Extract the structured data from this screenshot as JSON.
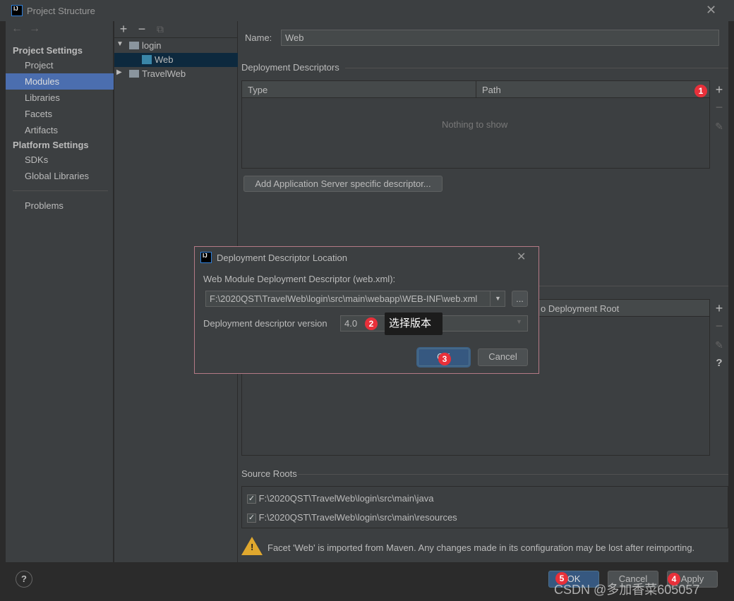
{
  "window": {
    "title": "Project Structure",
    "logo": "IJ"
  },
  "sidebar": {
    "nav": {
      "back": "←",
      "forward": "→"
    },
    "project_settings": "Project Settings",
    "project_items": [
      {
        "label": "Project"
      },
      {
        "label": "Modules",
        "selected": true
      },
      {
        "label": "Libraries"
      },
      {
        "label": "Facets"
      },
      {
        "label": "Artifacts"
      }
    ],
    "platform_settings": "Platform Settings",
    "platform_items": [
      {
        "label": "SDKs"
      },
      {
        "label": "Global Libraries"
      }
    ],
    "problems": "Problems"
  },
  "tree": {
    "toolbar": {
      "add": "+",
      "remove": "−",
      "copy": "⧉"
    },
    "nodes": [
      {
        "label": "login",
        "expanded": true
      },
      {
        "label": "Web",
        "selected": true
      },
      {
        "label": "TravelWeb",
        "expanded": false
      }
    ]
  },
  "main": {
    "name_label": "Name:",
    "name_value": "Web",
    "deployment_descriptors": "Deployment Descriptors",
    "columns": [
      "Type",
      "Path"
    ],
    "empty_text": "Nothing to show",
    "add_server_descriptor": "Add Application Server specific descriptor...",
    "web_root_header": "o Deployment Root",
    "source_roots": "Source Roots",
    "source_root_items": [
      {
        "path": "F:\\2020QST\\TravelWeb\\login\\src\\main\\java",
        "checked": true
      },
      {
        "path": "F:\\2020QST\\TravelWeb\\login\\src\\main\\resources",
        "checked": true
      }
    ],
    "warning": "Facet 'Web' is imported from Maven. Any changes made in its configuration may be lost after reimporting."
  },
  "footer": {
    "help": "?",
    "ok": "OK",
    "cancel": "Cancel",
    "apply": "Apply"
  },
  "dialog": {
    "title": "Deployment Descriptor Location",
    "logo": "IJ",
    "descriptor_label": "Web Module Deployment Descriptor (web.xml):",
    "descriptor_path": "F:\\2020QST\\TravelWeb\\login\\src\\main\\webapp\\WEB-INF\\web.xml",
    "browse": "...",
    "version_label": "Deployment descriptor version",
    "version_value": "4.0",
    "ok": "OK",
    "cancel": "Cancel"
  },
  "annotations": {
    "tooltip": "选择版本",
    "badges": [
      "1",
      "2",
      "3",
      "4",
      "5"
    ],
    "badge_color": "#e8303a"
  },
  "watermark": "CSDN @多加香菜605057"
}
